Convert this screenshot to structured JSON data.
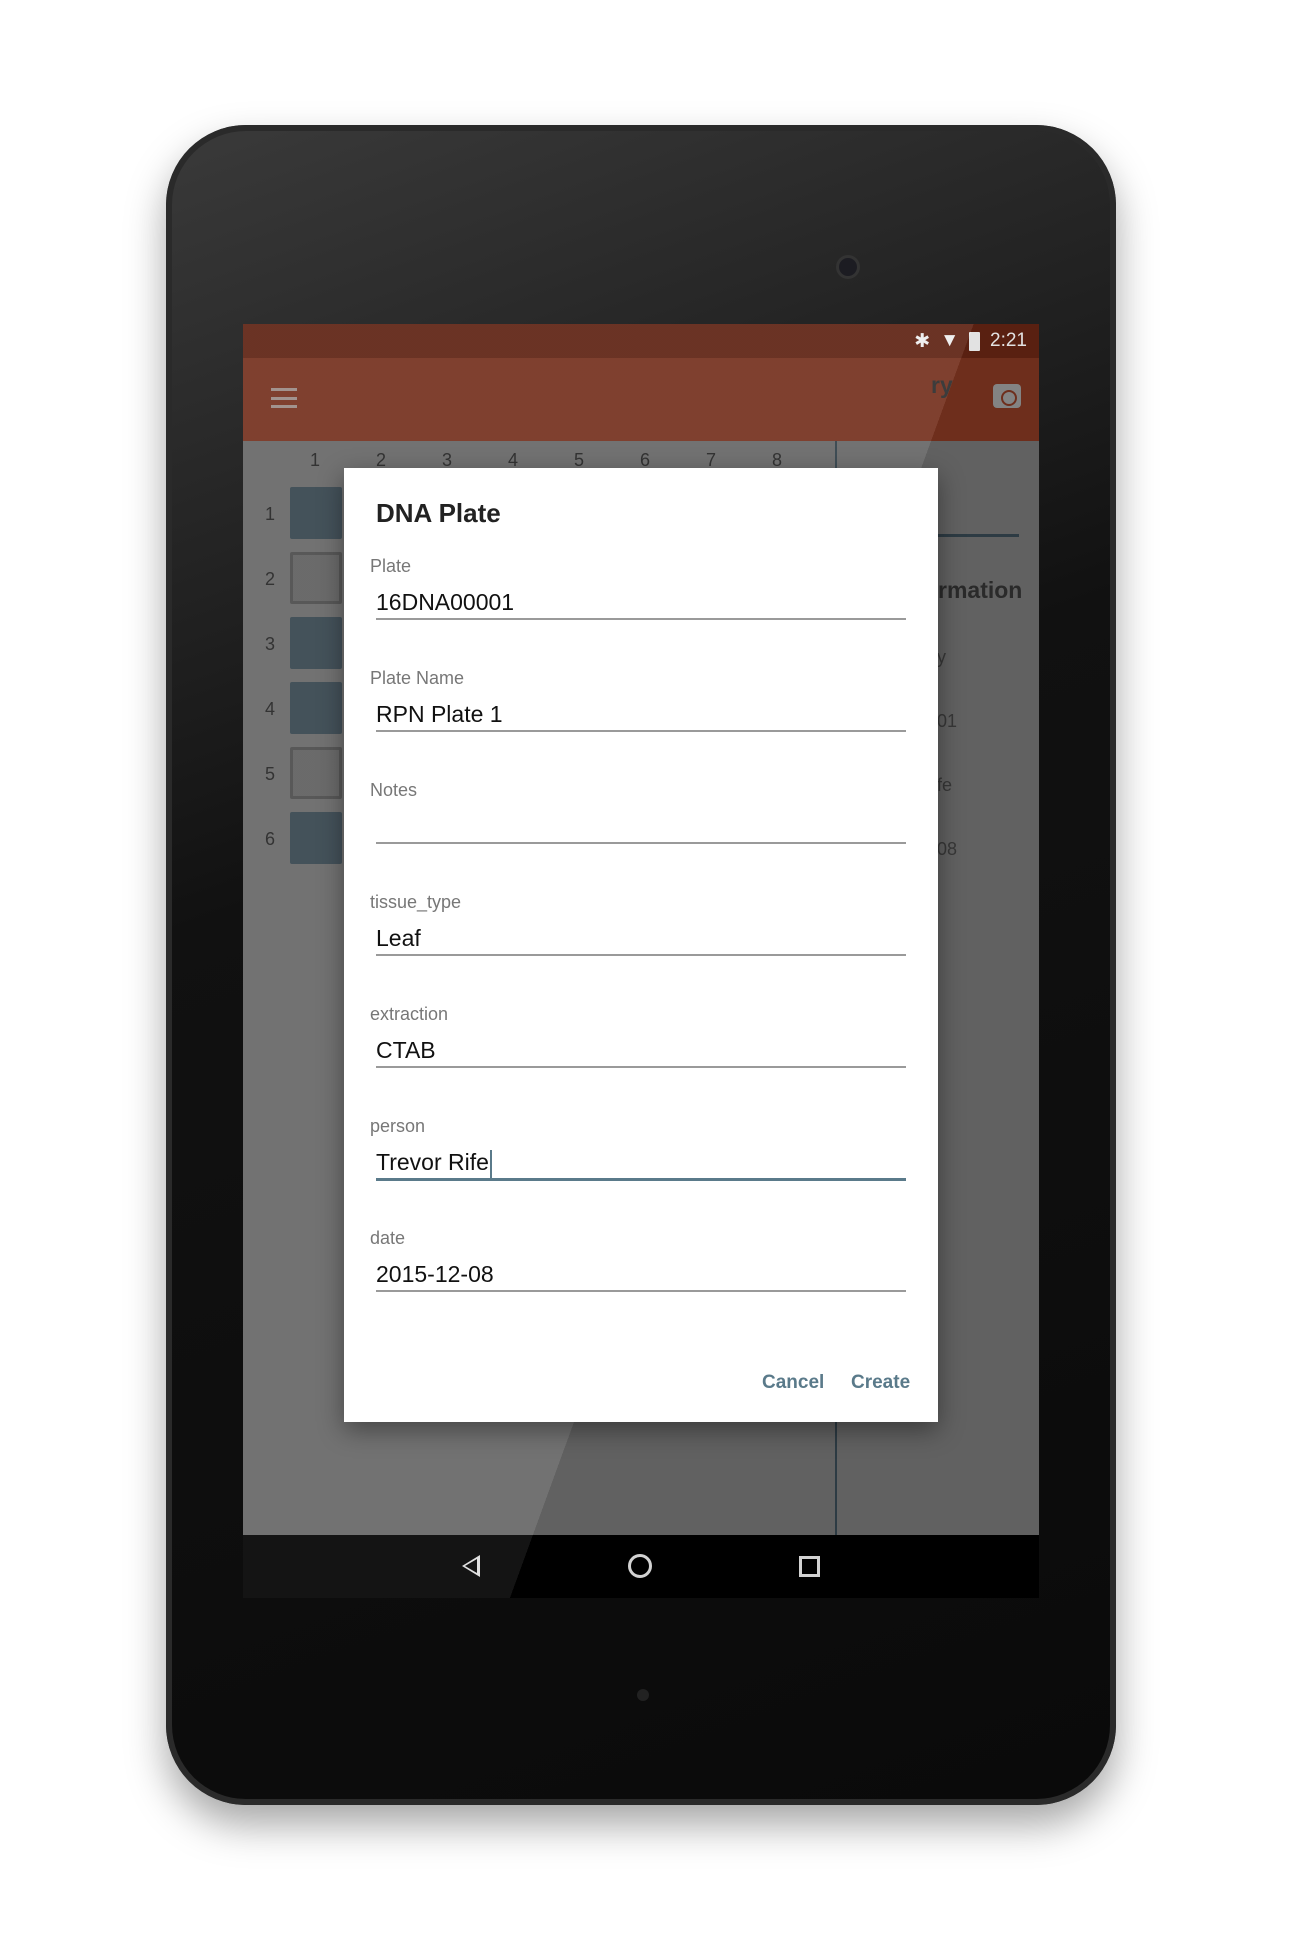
{
  "status_bar": {
    "time": "2:21",
    "icons": [
      "bluetooth-icon",
      "wifi-icon",
      "battery-icon"
    ]
  },
  "toolbar": {
    "icons": [
      "menu-icon",
      "camera-icon"
    ],
    "color": "#74301d"
  },
  "plate_grid": {
    "columns": [
      "1",
      "2",
      "3",
      "4",
      "5",
      "6",
      "7",
      "8"
    ],
    "rows": [
      "1",
      "2",
      "3",
      "4",
      "5",
      "6"
    ],
    "wells_first_column": [
      "filled",
      "empty",
      "filled",
      "filled",
      "empty",
      "filled"
    ]
  },
  "right_panel": {
    "fragments": [
      "ry",
      "rmation",
      "y",
      "01",
      "fe",
      "08"
    ]
  },
  "dialog": {
    "title": "DNA Plate",
    "fields": [
      {
        "label": "Plate",
        "value": "16DNA00001"
      },
      {
        "label": "Plate Name",
        "value": "RPN Plate 1"
      },
      {
        "label": "Notes",
        "value": ""
      },
      {
        "label": "tissue_type",
        "value": "Leaf"
      },
      {
        "label": "extraction",
        "value": "CTAB"
      },
      {
        "label": "person",
        "value": "Trevor Rife",
        "focused": true
      },
      {
        "label": "date",
        "value": "2015-12-08"
      }
    ],
    "cancel_label": "Cancel",
    "create_label": "Create",
    "accent": "#5a7a8a"
  }
}
